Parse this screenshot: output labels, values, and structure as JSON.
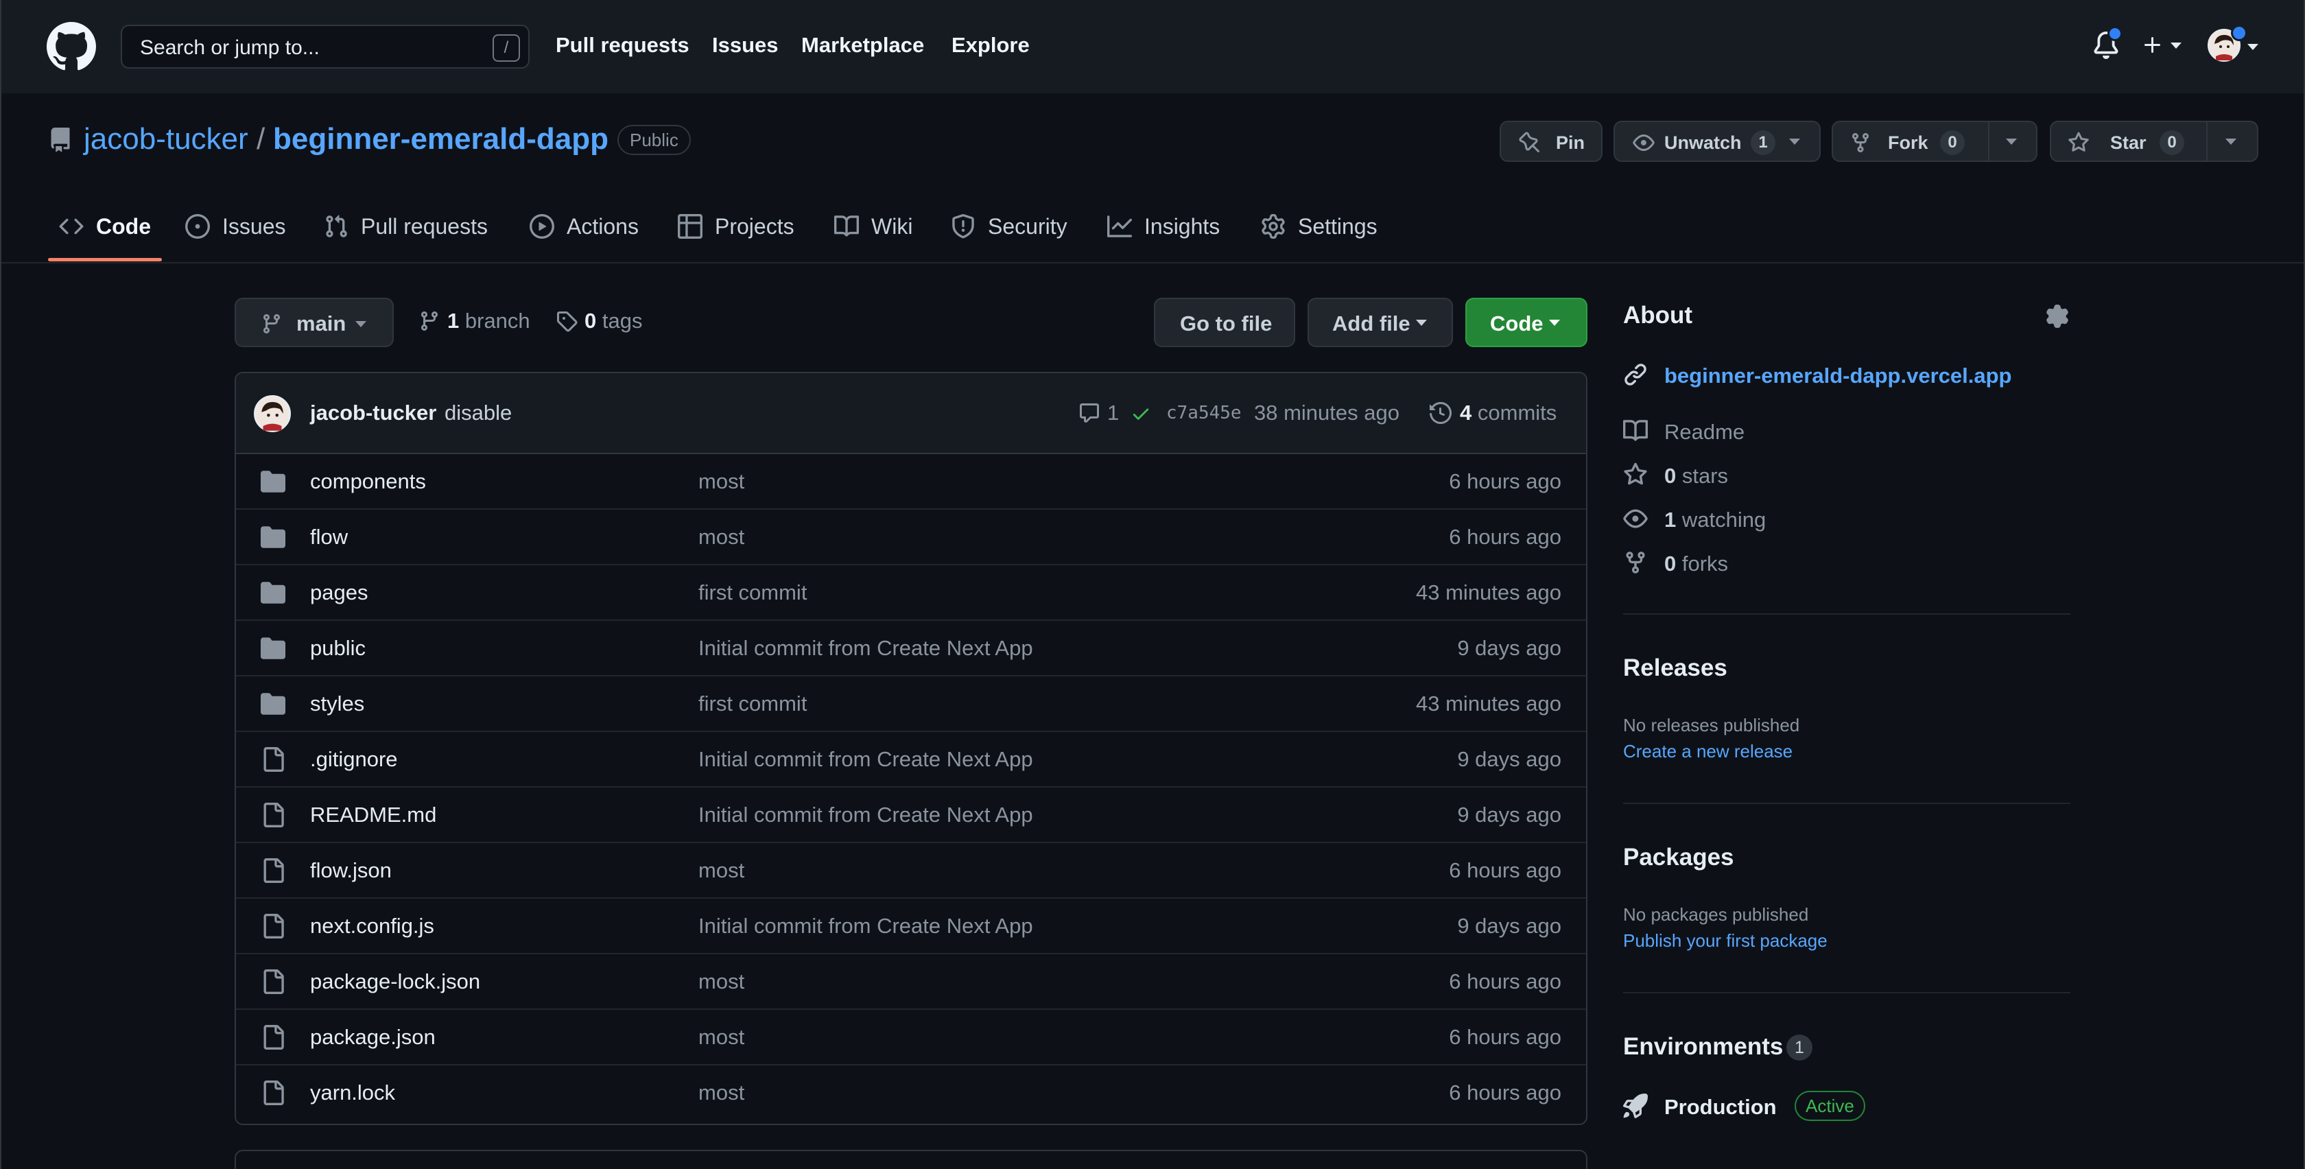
{
  "header": {
    "search_placeholder": "Search or jump to...",
    "search_shortcut": "/",
    "nav": [
      "Pull requests",
      "Issues",
      "Marketplace",
      "Explore"
    ]
  },
  "repo": {
    "owner": "jacob-tucker",
    "separator": "/",
    "name": "beginner-emerald-dapp",
    "visibility": "Public",
    "pin_label": "Pin",
    "unwatch_label": "Unwatch",
    "watch_count": "1",
    "fork_label": "Fork",
    "fork_count": "0",
    "star_label": "Star",
    "star_count": "0"
  },
  "tabs": [
    {
      "label": "Code",
      "icon": "code-icon",
      "selected": true
    },
    {
      "label": "Issues",
      "icon": "issue-opened-icon"
    },
    {
      "label": "Pull requests",
      "icon": "git-pull-request-icon"
    },
    {
      "label": "Actions",
      "icon": "play-icon"
    },
    {
      "label": "Projects",
      "icon": "table-icon"
    },
    {
      "label": "Wiki",
      "icon": "book-icon"
    },
    {
      "label": "Security",
      "icon": "shield-icon"
    },
    {
      "label": "Insights",
      "icon": "graph-icon"
    },
    {
      "label": "Settings",
      "icon": "gear-icon"
    }
  ],
  "toolbar": {
    "branch": "main",
    "branch_count": "1",
    "branch_label": "branch",
    "tag_count": "0",
    "tag_label": "tags",
    "go_to_file": "Go to file",
    "add_file": "Add file",
    "code": "Code"
  },
  "latest_commit": {
    "author": "jacob-tucker",
    "message": "disable",
    "comments": "1",
    "sha": "c7a545e",
    "age": "38 minutes ago",
    "commit_count": "4",
    "commit_label": "commits"
  },
  "files": [
    {
      "name": "components",
      "type": "dir",
      "message": "most",
      "age": "6 hours ago"
    },
    {
      "name": "flow",
      "type": "dir",
      "message": "most",
      "age": "6 hours ago"
    },
    {
      "name": "pages",
      "type": "dir",
      "message": "first commit",
      "age": "43 minutes ago"
    },
    {
      "name": "public",
      "type": "dir",
      "message": "Initial commit from Create Next App",
      "age": "9 days ago"
    },
    {
      "name": "styles",
      "type": "dir",
      "message": "first commit",
      "age": "43 minutes ago"
    },
    {
      "name": ".gitignore",
      "type": "file",
      "message": "Initial commit from Create Next App",
      "age": "9 days ago"
    },
    {
      "name": "README.md",
      "type": "file",
      "message": "Initial commit from Create Next App",
      "age": "9 days ago"
    },
    {
      "name": "flow.json",
      "type": "file",
      "message": "most",
      "age": "6 hours ago"
    },
    {
      "name": "next.config.js",
      "type": "file",
      "message": "Initial commit from Create Next App",
      "age": "9 days ago"
    },
    {
      "name": "package-lock.json",
      "type": "file",
      "message": "most",
      "age": "6 hours ago"
    },
    {
      "name": "package.json",
      "type": "file",
      "message": "most",
      "age": "6 hours ago"
    },
    {
      "name": "yarn.lock",
      "type": "file",
      "message": "most",
      "age": "6 hours ago"
    }
  ],
  "about": {
    "title": "About",
    "website": "beginner-emerald-dapp.vercel.app",
    "readme": "Readme",
    "stars_count": "0",
    "stars_label": "stars",
    "watching_count": "1",
    "watching_label": "watching",
    "forks_count": "0",
    "forks_label": "forks"
  },
  "releases": {
    "title": "Releases",
    "empty": "No releases published",
    "link": "Create a new release"
  },
  "packages": {
    "title": "Packages",
    "empty": "No packages published",
    "link": "Publish your first package"
  },
  "environments": {
    "title": "Environments",
    "count": "1",
    "name": "Production",
    "status": "Active"
  },
  "colors": {
    "background": "#0d1117",
    "header": "#161b22",
    "link": "#58a6ff",
    "accent_tab": "#f78166",
    "primary_button": "#238636",
    "success": "#3fb950"
  }
}
